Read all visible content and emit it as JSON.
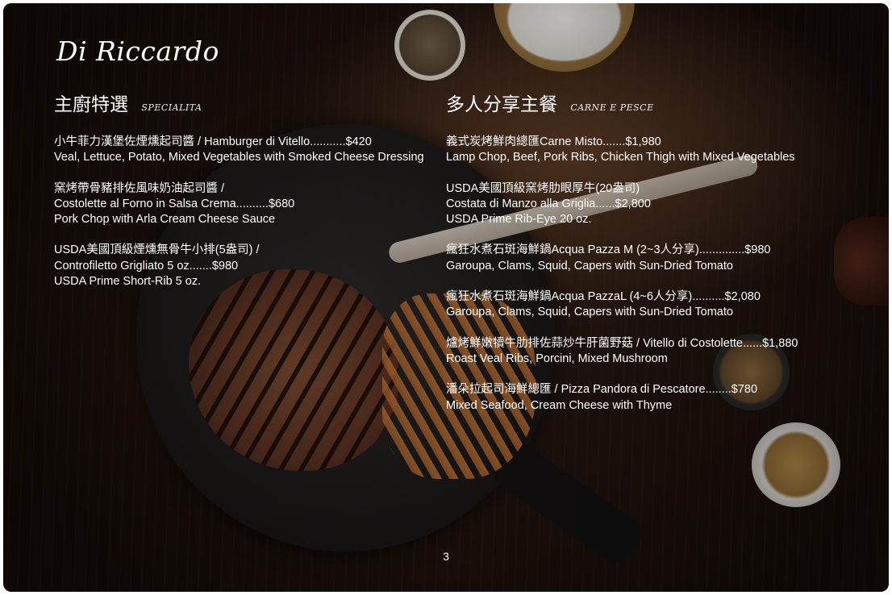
{
  "brand": "Di Riccardo",
  "left_section": {
    "title": "主廚特選",
    "subtitle": "SPECIALITA",
    "items": [
      {
        "lines": [
          "小牛菲力漢堡佐煙燻起司醬 / Hamburger di Vitello...........$420",
          "Veal, Lettuce, Potato, Mixed Vegetables with Smoked Cheese Dressing"
        ]
      },
      {
        "lines": [
          "窯烤帶骨豬排佐風味奶油起司醬 /",
          "Costolette al Forno in Salsa Crema..........$680",
          "Pork Chop with Arla Cream Cheese Sauce"
        ]
      },
      {
        "lines": [
          "USDA美國頂級煙燻無骨牛小排(5盎司) /",
          "Controfiletto Grigliato 5 oz.......$980",
          "USDA Prime Short-Rib 5 oz."
        ]
      }
    ]
  },
  "right_section": {
    "title": "多人分享主餐",
    "subtitle": "CARNE E PESCE",
    "items": [
      {
        "lines": [
          "義式炭烤鮮肉總匯Carne Misto.......$1,980",
          "Lamp Chop, Beef, Pork Ribs, Chicken Thigh with Mixed Vegetables"
        ]
      },
      {
        "lines": [
          "USDA美國頂級窯烤肋眼厚牛(20盎司)",
          "Costata di Manzo alla Griglia......$2,800",
          "USDA Prime Rib-Eye 20 oz."
        ]
      },
      {
        "lines": [
          "瘋狂水煮石斑海鮮鍋Acqua Pazza M (2~3人分享)..............$980",
          "Garoupa, Clams, Squid, Capers with Sun-Dried Tomato"
        ]
      },
      {
        "lines": [
          "瘋狂水煮石斑海鮮鍋Acqua PazzaL (4~6人分享)..........$2,080",
          "Garoupa, Clams, Squid, Capers with Sun-Dried Tomato"
        ]
      },
      {
        "lines": [
          "爐烤鮮嫩犢牛肋排佐蒜炒牛肝菌野菇 / Vitello di Costolette......$1,880",
          "Roast Veal Ribs, Porcini, Mixed Mushroom"
        ]
      },
      {
        "lines": [
          "潘朵拉起司海鮮總匯 / Pizza Pandora di Pescatore........$780",
          "Mixed Seafood, Cream Cheese with Thyme"
        ]
      }
    ]
  },
  "page_number": "3",
  "colors": {
    "text": "#ffffff",
    "background": "#1c120d"
  }
}
